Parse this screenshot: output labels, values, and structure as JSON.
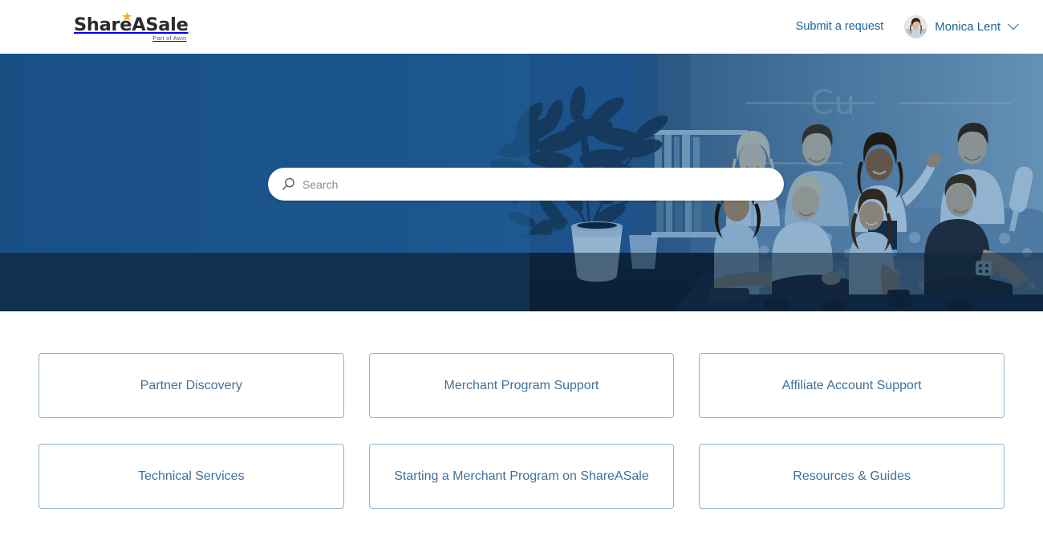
{
  "header": {
    "logo": {
      "name": "ShareASale",
      "tagline": "Part of Awin",
      "star_color": "#f5b324"
    },
    "submit_request_label": "Submit a request",
    "user": {
      "name": "Monica Lent",
      "chevron_icon": "chevron-down-icon",
      "avatar_icon": "avatar"
    },
    "link_color": "#1f6295"
  },
  "hero": {
    "search": {
      "placeholder": "Search",
      "value": "",
      "icon": "search-icon"
    },
    "background": {
      "description": "Group of people on a couch in a living room with a large potted plant, blue duotone overlay",
      "wall_color": "#1e5b8f",
      "floor_color": "#10263c",
      "tint_light": "#aacbe0"
    }
  },
  "cards": [
    {
      "label": "Partner Discovery"
    },
    {
      "label": "Merchant Program Support"
    },
    {
      "label": "Affiliate Account Support"
    },
    {
      "label": "Technical Services"
    },
    {
      "label": "Starting a Merchant Program on ShareASale"
    },
    {
      "label": "Resources & Guides"
    }
  ],
  "theme": {
    "card_border": "#91b4ce",
    "card_text": "#3f7199",
    "page_background": "#ffffff"
  }
}
